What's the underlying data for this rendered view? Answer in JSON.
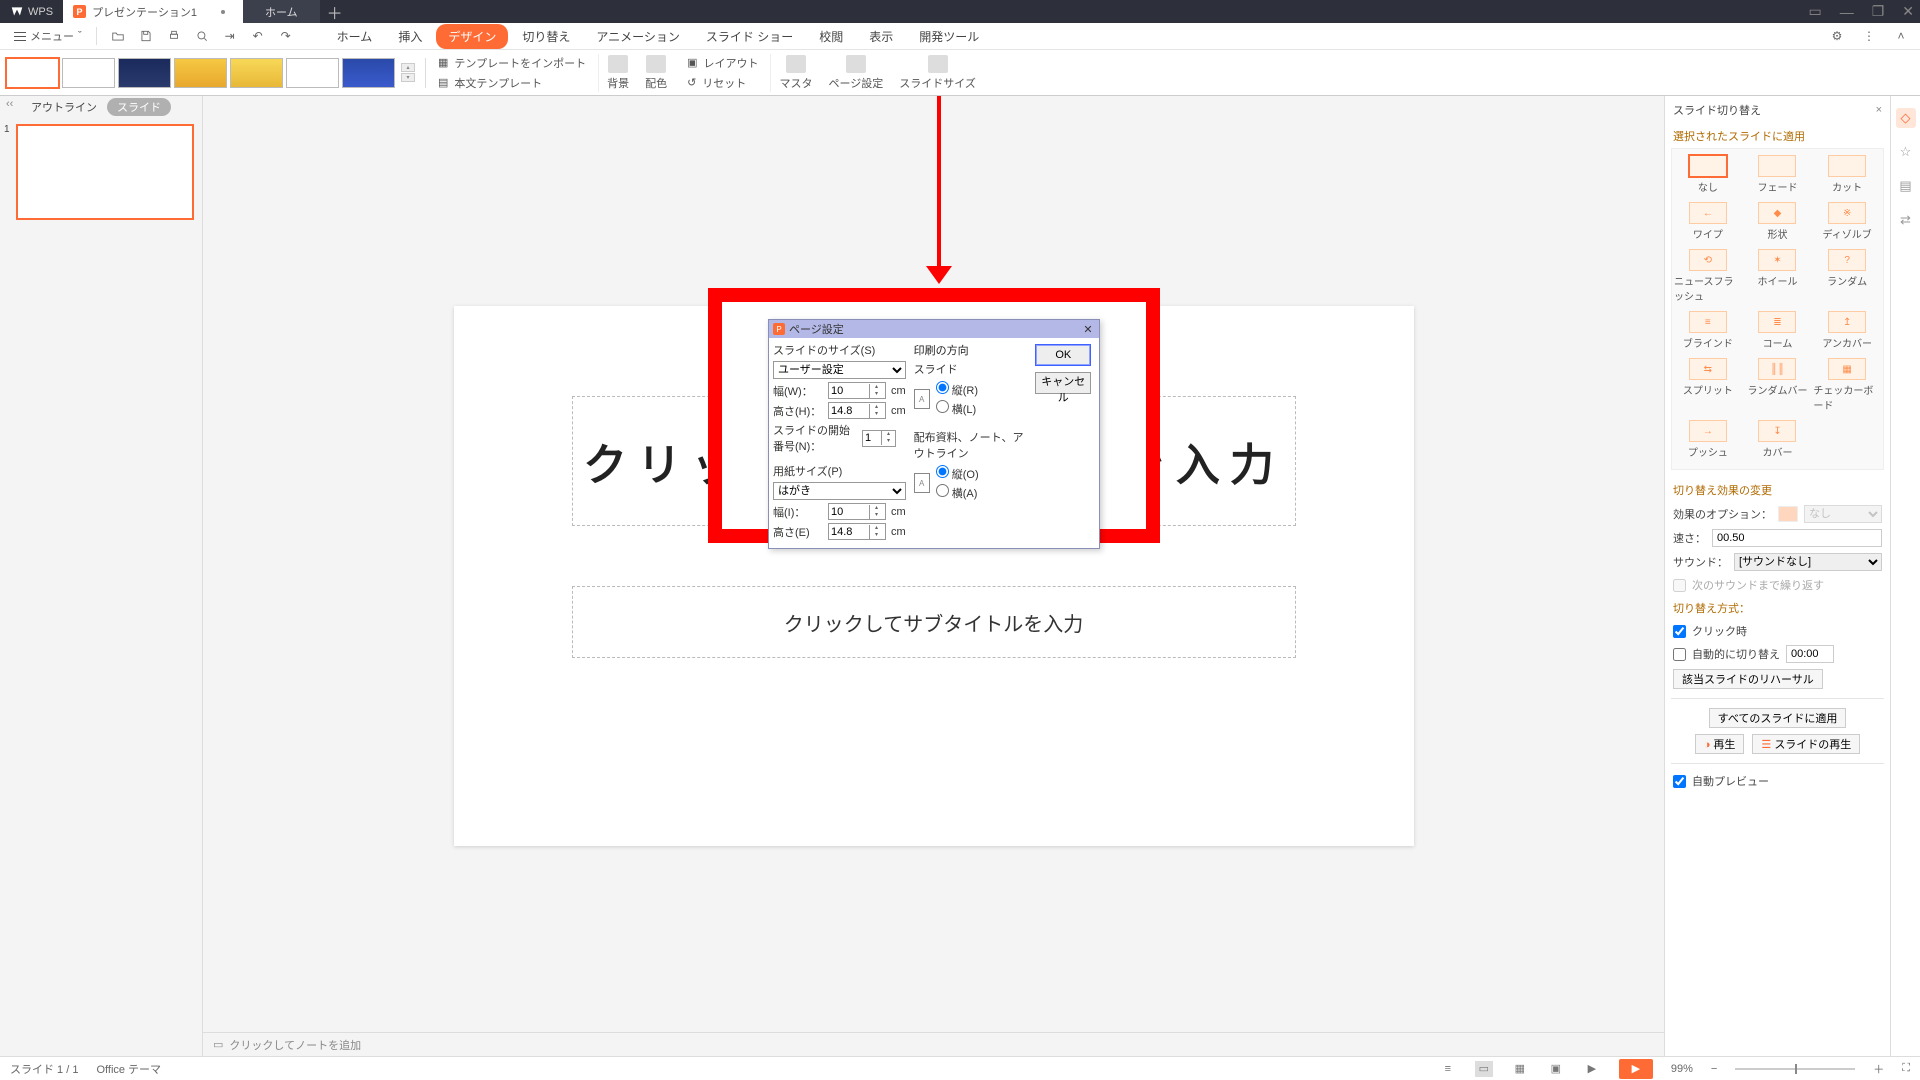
{
  "titlebar": {
    "app": "WPS",
    "tab_doc": "プレゼンテーション1",
    "tab_home": "ホーム"
  },
  "menubar": {
    "menu_label": "メニュー",
    "tabs": {
      "home": "ホーム",
      "insert": "挿入",
      "design": "デザイン",
      "transition": "切り替え",
      "animation": "アニメーション",
      "slideshow": "スライド ショー",
      "review": "校閲",
      "view": "表示",
      "devtools": "開発ツール"
    }
  },
  "ribbon": {
    "import_template": "テンプレートをインポート",
    "body_template": "本文テンプレート",
    "background": "背景",
    "colors": "配色",
    "layout": "レイアウト",
    "reset": "リセット",
    "master": "マスタ",
    "page_setup": "ページ設定",
    "slide_size": "スライドサイズ"
  },
  "leftpanel": {
    "outline": "アウトライン",
    "slides": "スライド",
    "slidenum": "1"
  },
  "slide": {
    "title": "クリックしてタイトルを入力",
    "subtitle": "クリックしてサブタイトルを入力"
  },
  "notes": {
    "prompt": "クリックしてノートを追加"
  },
  "rightpanel": {
    "head": "スライド切り替え",
    "close": "×",
    "apply_to": "選択されたスライドに適用",
    "trans": [
      "なし",
      "フェード",
      "カット",
      "ワイプ",
      "形状",
      "ディゾルブ",
      "ニュースフラッシュ",
      "ホイール",
      "ランダム",
      "ブラインド",
      "コーム",
      "アンカバー",
      "スプリット",
      "ランダムバー",
      "チェッカーボード",
      "プッシュ",
      "カバー"
    ],
    "change": "切り替え効果の変更",
    "option_lbl": "効果のオプション：",
    "option_val": "なし",
    "speed_lbl": "速さ：",
    "speed_val": "00.50",
    "sound_lbl": "サウンド：",
    "sound_val": "[サウンドなし]",
    "loop_sound": "次のサウンドまで繰り返す",
    "method": "切り替え方式：",
    "on_click": "クリック時",
    "auto_after": "自動的に切り替え",
    "auto_time": "00:00",
    "rehearse": "該当スライドのリハーサル",
    "apply_all": "すべてのスライドに適用",
    "play": "再生",
    "play_slide": "スライドの再生",
    "auto_preview": "自動プレビュー"
  },
  "status": {
    "slide": "スライド 1 / 1",
    "theme": "Office テーマ",
    "zoom": "99%"
  },
  "dialog": {
    "title": "ページ設定",
    "slide_size_lbl": "スライドのサイズ(S)",
    "slide_size_val": "ユーザー設定",
    "width_lbl": "幅(W)：",
    "width_val": "10",
    "height_lbl": "高さ(H)：",
    "height_val": "14.8",
    "start_no_lbl": "スライドの開始番号(N)：",
    "start_no_val": "1",
    "paper_lbl": "用紙サイズ(P)",
    "paper_val": "はがき",
    "pwidth_lbl": "幅(I)：",
    "pwidth_val": "10",
    "pheight_lbl": "高さ(E)",
    "pheight_val": "14.8",
    "print_dir": "印刷の方向",
    "slide_dir": "スライド",
    "portrait_r": "縦(R)",
    "landscape_l": "横(L)",
    "other_dir": "配布資料、ノート、アウトライン",
    "portrait_o": "縦(O)",
    "landscape_a": "横(A)",
    "cm": "cm",
    "ok": "OK",
    "cancel": "キャンセル"
  }
}
